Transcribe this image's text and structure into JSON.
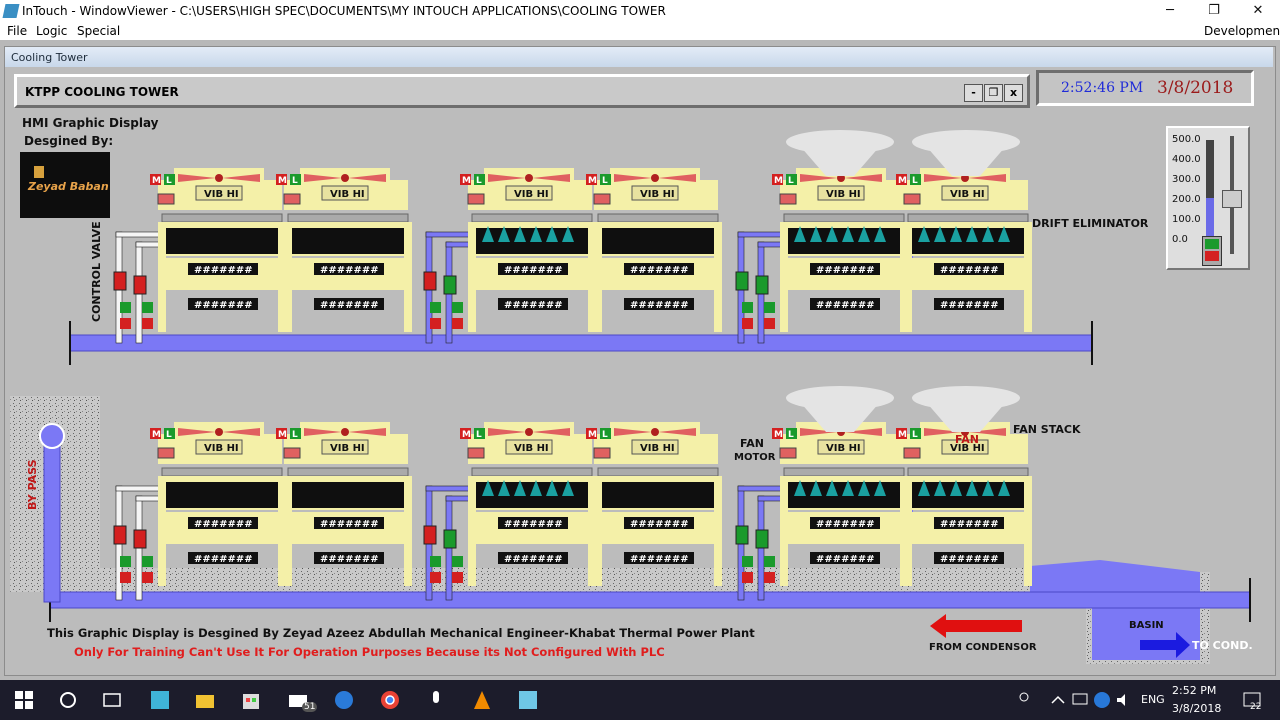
{
  "window": {
    "title": "InTouch - WindowViewer - C:\\USERS\\HIGH SPEC\\DOCUMENTS\\MY INTOUCH APPLICATIONS\\COOLING TOWER",
    "controls": {
      "minimize": "─",
      "restore": "❐",
      "close": "✕"
    }
  },
  "menu": {
    "file": "File",
    "logic": "Logic",
    "special": "Special",
    "right": "Development!"
  },
  "frame": {
    "title": "Cooling Tower"
  },
  "header": {
    "title": "KTPP COOLING TOWER",
    "min": "-",
    "restore": "❐",
    "close": "x"
  },
  "clock": {
    "time": "2:52:46 PM",
    "date": "3/8/2018"
  },
  "left": {
    "hmi": "HMI Graphic Display",
    "designed_by": "Desgined By:",
    "logo_name": "Zeyad Baban"
  },
  "labels": {
    "control_valve": "CONTROL VALVE",
    "drift_eliminator": "DRIFT ELIMINATOR",
    "fan_stack": "FAN STACK",
    "fan": "FAN",
    "fan_motor_1": "FAN",
    "fan_motor_2": "MOTOR",
    "by_pass": "BY PASS",
    "from_condensor": "FROM CONDENSOR",
    "basin": "BASIN",
    "to_cond": "TO COND.",
    "vib_hi": "VIB HI",
    "placeholder": "#######",
    "m": "M",
    "l": "L"
  },
  "slider": {
    "ticks": [
      "500.0",
      "400.0",
      "300.0",
      "200.0",
      "100.0",
      "0.0"
    ]
  },
  "footer": {
    "line1": "This Graphic Display is Desgined By Zeyad Azeez Abdullah Mechanical Engineer-Khabat Thermal Power Plant",
    "line2": "Only For Training Can't Use It For Operation Purposes Because its Not Configured With PLC"
  },
  "taskbar": {
    "time": "2:52 PM",
    "date": "3/8/2018",
    "lang": "ENG",
    "mail_badge": "51",
    "notif_badge": "22"
  },
  "colors": {
    "pipe": "#7b78f5",
    "tower": "#f4f0a8",
    "red": "#d42020",
    "green": "#1a9a2c",
    "fill": "#0f0f0f"
  }
}
